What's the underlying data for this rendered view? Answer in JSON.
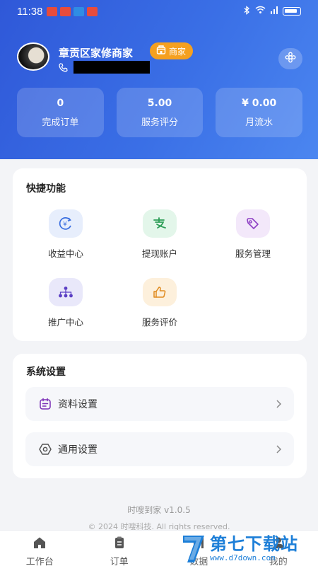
{
  "status_bar": {
    "time": "11:38"
  },
  "profile": {
    "shop_name": "章贡区家修商家",
    "badge": "商家"
  },
  "stats": [
    {
      "value": "0",
      "label": "完成订单"
    },
    {
      "value": "5.00",
      "label": "服务评分"
    },
    {
      "value": "¥ 0.00",
      "label": "月流水"
    }
  ],
  "quick_functions": {
    "title": "快捷功能",
    "items": [
      {
        "label": "收益中心",
        "icon": "yen-coin-icon",
        "color": "#3b6fe0",
        "bg": "#e7eefc"
      },
      {
        "label": "提现账户",
        "icon": "alipay-icon",
        "color": "#2e9e58",
        "bg": "#e3f6ea"
      },
      {
        "label": "服务管理",
        "icon": "tag-icon",
        "color": "#8e3fc4",
        "bg": "#f3e8fa"
      },
      {
        "label": "推广中心",
        "icon": "network-icon",
        "color": "#5b3fc4",
        "bg": "#e9e8fa"
      },
      {
        "label": "服务评价",
        "icon": "thumbs-up-icon",
        "color": "#e08a1e",
        "bg": "#fdf0dc"
      }
    ]
  },
  "system_settings": {
    "title": "系统设置",
    "items": [
      {
        "label": "资料设置",
        "icon": "profile-card-icon",
        "color": "#7a2fb6"
      },
      {
        "label": "通用设置",
        "icon": "settings-cog-icon",
        "color": "#555555"
      }
    ]
  },
  "footer": {
    "version": "时嗖到家 v1.0.5",
    "copyright": "© 2024 时嗖科技. All rights reserved."
  },
  "tabbar": {
    "items": [
      {
        "label": "工作台",
        "icon": "home-icon"
      },
      {
        "label": "订单",
        "icon": "orders-icon"
      },
      {
        "label": "数据",
        "icon": "stats-icon"
      },
      {
        "label": "我的",
        "icon": "user-icon"
      }
    ]
  },
  "watermark": {
    "name": "第七下载站",
    "url": "www.d7down.com"
  }
}
